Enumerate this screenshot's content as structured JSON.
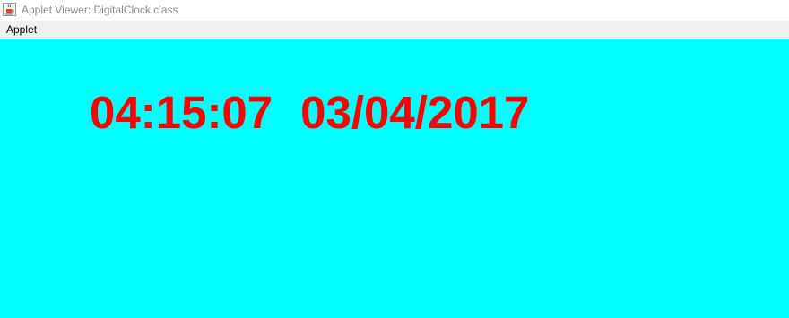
{
  "window": {
    "title": "Applet Viewer: DigitalClock.class",
    "icon": "java-coffee-cup-icon"
  },
  "menubar": {
    "items": [
      {
        "label": "Applet"
      }
    ]
  },
  "applet": {
    "background_color": "#00ffff",
    "text_color": "#ff0000",
    "time": "04:15:07",
    "date": "03/04/2017"
  }
}
